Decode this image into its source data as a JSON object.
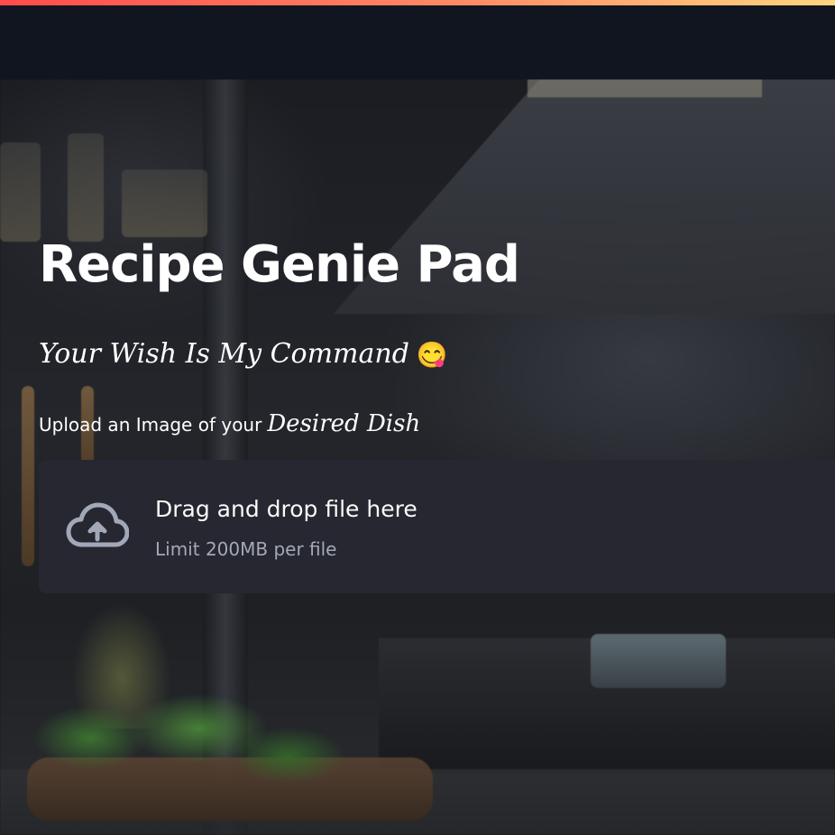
{
  "app": {
    "title": "Recipe Genie Pad",
    "tagline": "Your Wish Is My Command",
    "tagline_emoji": "😋"
  },
  "uploader": {
    "label_prefix": "Upload an Image of your",
    "label_emphasis": "Desired Dish",
    "dropzone_title": "Drag and drop file here",
    "dropzone_limit": "Limit 200MB per file",
    "icon": "cloud-upload-icon"
  },
  "colors": {
    "header_bg": "#111520",
    "dropzone_bg": "#262730",
    "accent_gradient_start": "#ff4b4b",
    "accent_gradient_end": "#ffd580",
    "title_text": "#ffffff",
    "muted_text": "#a3a8b8"
  }
}
